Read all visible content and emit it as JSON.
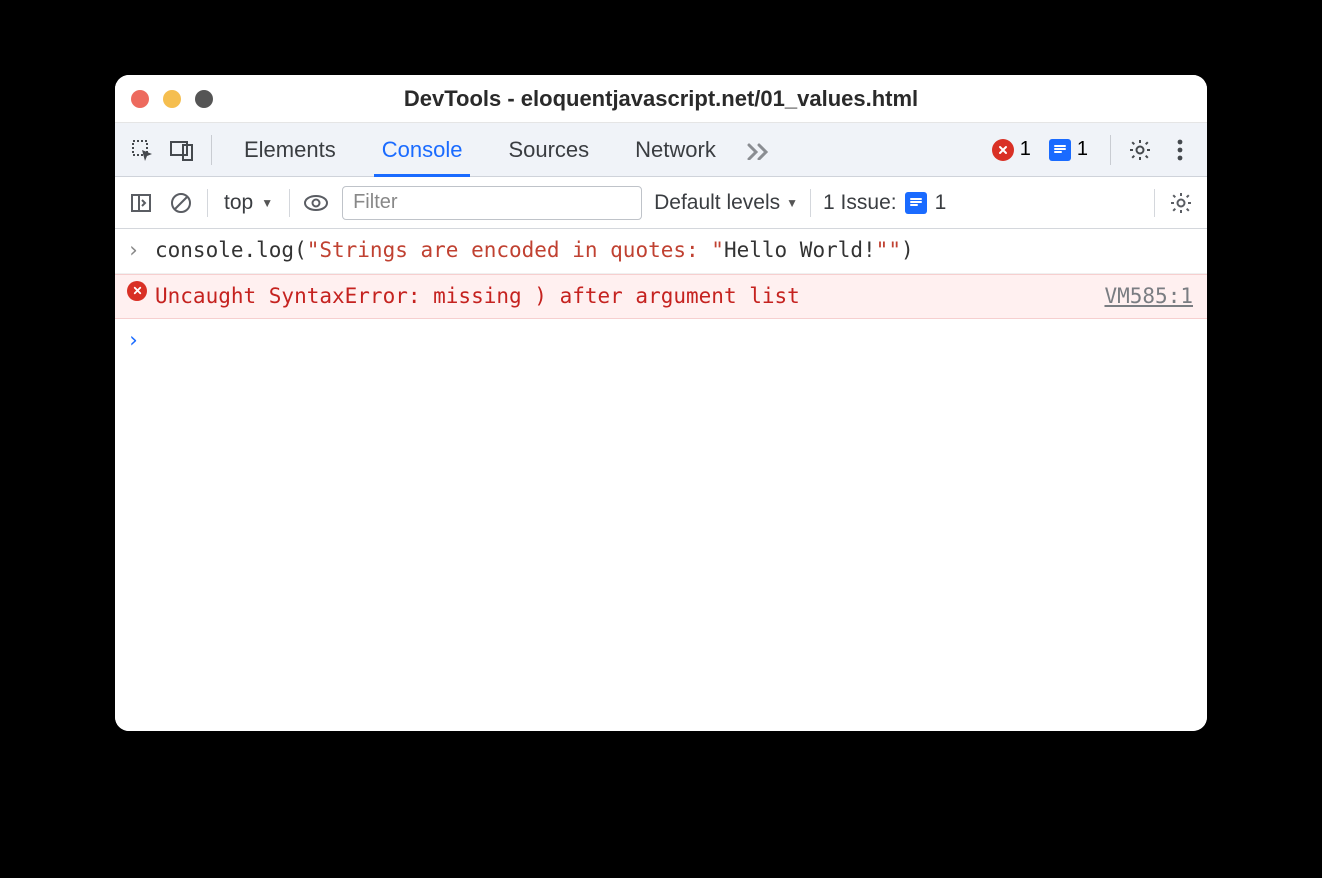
{
  "window": {
    "title": "DevTools - eloquentjavascript.net/01_values.html"
  },
  "tabs": {
    "elements": "Elements",
    "console": "Console",
    "sources": "Sources",
    "network": "Network"
  },
  "counters": {
    "errors": "1",
    "issues": "1"
  },
  "consoleToolbar": {
    "context": "top",
    "filterPlaceholder": "Filter",
    "levels": "Default levels",
    "issuesLabel": "1 Issue:",
    "issuesCount": "1"
  },
  "console": {
    "input": {
      "seg1": "console.log(",
      "seg2": "\"Strings are encoded in quotes: \"",
      "seg3": "Hello World!",
      "seg4": "\"\"",
      "seg5": ")"
    },
    "error": {
      "message": "Uncaught SyntaxError: missing ) after argument list",
      "source": "VM585:1"
    }
  }
}
